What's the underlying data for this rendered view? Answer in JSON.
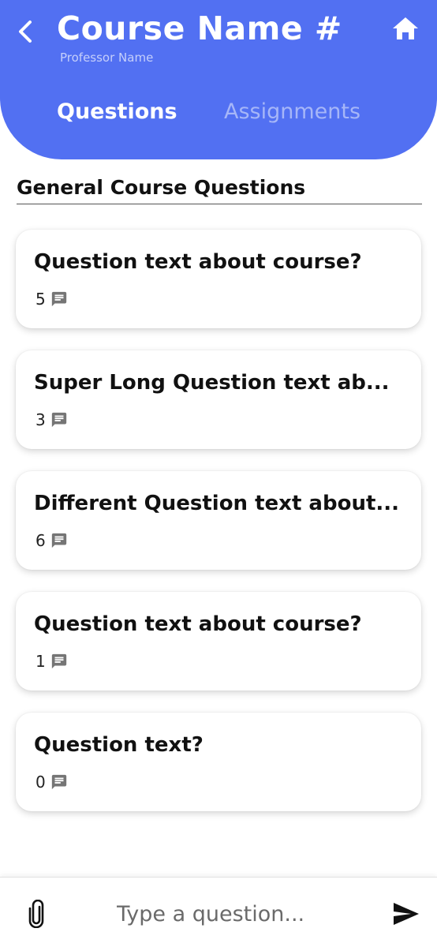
{
  "header": {
    "course_title": "Course Name #",
    "professor": "Professor Name",
    "back_icon": "chevron-left-icon",
    "home_icon": "home-icon",
    "background_color": "#5270f2"
  },
  "tabs": [
    {
      "label": "Questions",
      "active": true
    },
    {
      "label": "Assignments",
      "active": false
    }
  ],
  "section": {
    "title": "General Course Questions"
  },
  "questions": [
    {
      "text": "Question text about course?",
      "comment_count": "5"
    },
    {
      "text": "Super Long Question text ab...",
      "comment_count": "3"
    },
    {
      "text": "Different Question text about...",
      "comment_count": "6"
    },
    {
      "text": "Question text about course?",
      "comment_count": "1"
    },
    {
      "text": "Question text?",
      "comment_count": "0"
    }
  ],
  "composer": {
    "placeholder": "Type a question...",
    "attach_icon": "paperclip-icon",
    "send_icon": "send-icon"
  }
}
